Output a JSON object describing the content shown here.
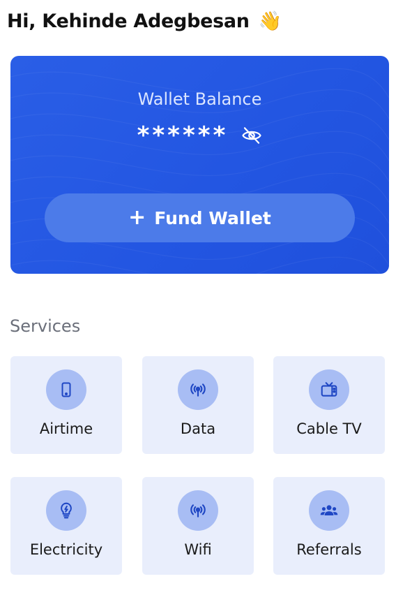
{
  "greeting": {
    "text": "Hi, Kehinde Adegbesan",
    "emoji": "👋"
  },
  "wallet": {
    "label": "Wallet Balance",
    "masked_balance": "******",
    "visibility_icon": "eye-off-icon",
    "fund_button": {
      "icon": "plus-icon",
      "label": "Fund Wallet"
    }
  },
  "services": {
    "title": "Services",
    "items": [
      {
        "label": "Airtime",
        "icon": "phone-icon"
      },
      {
        "label": "Data",
        "icon": "broadcast-icon"
      },
      {
        "label": "Cable TV",
        "icon": "tv-icon"
      },
      {
        "label": "Electricity",
        "icon": "lightbulb-icon"
      },
      {
        "label": "Wifi",
        "icon": "wifi-broadcast-icon"
      },
      {
        "label": "Referrals",
        "icon": "people-icon"
      }
    ]
  },
  "colors": {
    "primary": "#2356e2",
    "fund_button_bg": "#4c7be9",
    "tile_bg": "#e9eefc",
    "icon_circle": "#a8bdf4",
    "icon_fg": "#1f47c4"
  }
}
